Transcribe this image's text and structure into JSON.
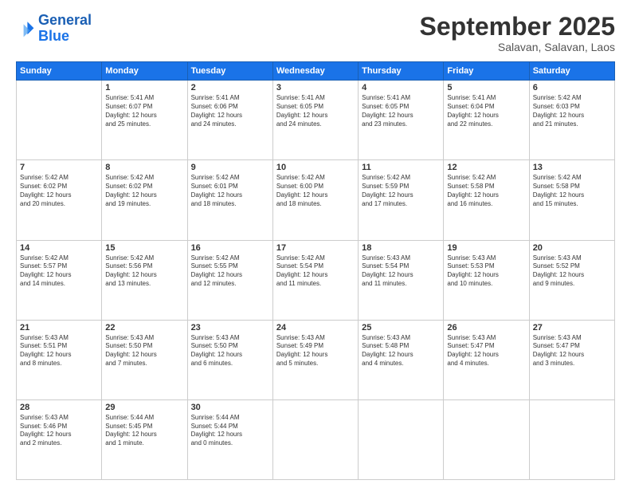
{
  "header": {
    "logo_line1": "General",
    "logo_line2": "Blue",
    "month": "September 2025",
    "location": "Salavan, Salavan, Laos"
  },
  "weekdays": [
    "Sunday",
    "Monday",
    "Tuesday",
    "Wednesday",
    "Thursday",
    "Friday",
    "Saturday"
  ],
  "weeks": [
    [
      {
        "day": "",
        "content": ""
      },
      {
        "day": "1",
        "content": "Sunrise: 5:41 AM\nSunset: 6:07 PM\nDaylight: 12 hours\nand 25 minutes."
      },
      {
        "day": "2",
        "content": "Sunrise: 5:41 AM\nSunset: 6:06 PM\nDaylight: 12 hours\nand 24 minutes."
      },
      {
        "day": "3",
        "content": "Sunrise: 5:41 AM\nSunset: 6:05 PM\nDaylight: 12 hours\nand 24 minutes."
      },
      {
        "day": "4",
        "content": "Sunrise: 5:41 AM\nSunset: 6:05 PM\nDaylight: 12 hours\nand 23 minutes."
      },
      {
        "day": "5",
        "content": "Sunrise: 5:41 AM\nSunset: 6:04 PM\nDaylight: 12 hours\nand 22 minutes."
      },
      {
        "day": "6",
        "content": "Sunrise: 5:42 AM\nSunset: 6:03 PM\nDaylight: 12 hours\nand 21 minutes."
      }
    ],
    [
      {
        "day": "7",
        "content": "Sunrise: 5:42 AM\nSunset: 6:02 PM\nDaylight: 12 hours\nand 20 minutes."
      },
      {
        "day": "8",
        "content": "Sunrise: 5:42 AM\nSunset: 6:02 PM\nDaylight: 12 hours\nand 19 minutes."
      },
      {
        "day": "9",
        "content": "Sunrise: 5:42 AM\nSunset: 6:01 PM\nDaylight: 12 hours\nand 18 minutes."
      },
      {
        "day": "10",
        "content": "Sunrise: 5:42 AM\nSunset: 6:00 PM\nDaylight: 12 hours\nand 18 minutes."
      },
      {
        "day": "11",
        "content": "Sunrise: 5:42 AM\nSunset: 5:59 PM\nDaylight: 12 hours\nand 17 minutes."
      },
      {
        "day": "12",
        "content": "Sunrise: 5:42 AM\nSunset: 5:58 PM\nDaylight: 12 hours\nand 16 minutes."
      },
      {
        "day": "13",
        "content": "Sunrise: 5:42 AM\nSunset: 5:58 PM\nDaylight: 12 hours\nand 15 minutes."
      }
    ],
    [
      {
        "day": "14",
        "content": "Sunrise: 5:42 AM\nSunset: 5:57 PM\nDaylight: 12 hours\nand 14 minutes."
      },
      {
        "day": "15",
        "content": "Sunrise: 5:42 AM\nSunset: 5:56 PM\nDaylight: 12 hours\nand 13 minutes."
      },
      {
        "day": "16",
        "content": "Sunrise: 5:42 AM\nSunset: 5:55 PM\nDaylight: 12 hours\nand 12 minutes."
      },
      {
        "day": "17",
        "content": "Sunrise: 5:42 AM\nSunset: 5:54 PM\nDaylight: 12 hours\nand 11 minutes."
      },
      {
        "day": "18",
        "content": "Sunrise: 5:43 AM\nSunset: 5:54 PM\nDaylight: 12 hours\nand 11 minutes."
      },
      {
        "day": "19",
        "content": "Sunrise: 5:43 AM\nSunset: 5:53 PM\nDaylight: 12 hours\nand 10 minutes."
      },
      {
        "day": "20",
        "content": "Sunrise: 5:43 AM\nSunset: 5:52 PM\nDaylight: 12 hours\nand 9 minutes."
      }
    ],
    [
      {
        "day": "21",
        "content": "Sunrise: 5:43 AM\nSunset: 5:51 PM\nDaylight: 12 hours\nand 8 minutes."
      },
      {
        "day": "22",
        "content": "Sunrise: 5:43 AM\nSunset: 5:50 PM\nDaylight: 12 hours\nand 7 minutes."
      },
      {
        "day": "23",
        "content": "Sunrise: 5:43 AM\nSunset: 5:50 PM\nDaylight: 12 hours\nand 6 minutes."
      },
      {
        "day": "24",
        "content": "Sunrise: 5:43 AM\nSunset: 5:49 PM\nDaylight: 12 hours\nand 5 minutes."
      },
      {
        "day": "25",
        "content": "Sunrise: 5:43 AM\nSunset: 5:48 PM\nDaylight: 12 hours\nand 4 minutes."
      },
      {
        "day": "26",
        "content": "Sunrise: 5:43 AM\nSunset: 5:47 PM\nDaylight: 12 hours\nand 4 minutes."
      },
      {
        "day": "27",
        "content": "Sunrise: 5:43 AM\nSunset: 5:47 PM\nDaylight: 12 hours\nand 3 minutes."
      }
    ],
    [
      {
        "day": "28",
        "content": "Sunrise: 5:43 AM\nSunset: 5:46 PM\nDaylight: 12 hours\nand 2 minutes."
      },
      {
        "day": "29",
        "content": "Sunrise: 5:44 AM\nSunset: 5:45 PM\nDaylight: 12 hours\nand 1 minute."
      },
      {
        "day": "30",
        "content": "Sunrise: 5:44 AM\nSunset: 5:44 PM\nDaylight: 12 hours\nand 0 minutes."
      },
      {
        "day": "",
        "content": ""
      },
      {
        "day": "",
        "content": ""
      },
      {
        "day": "",
        "content": ""
      },
      {
        "day": "",
        "content": ""
      }
    ]
  ]
}
